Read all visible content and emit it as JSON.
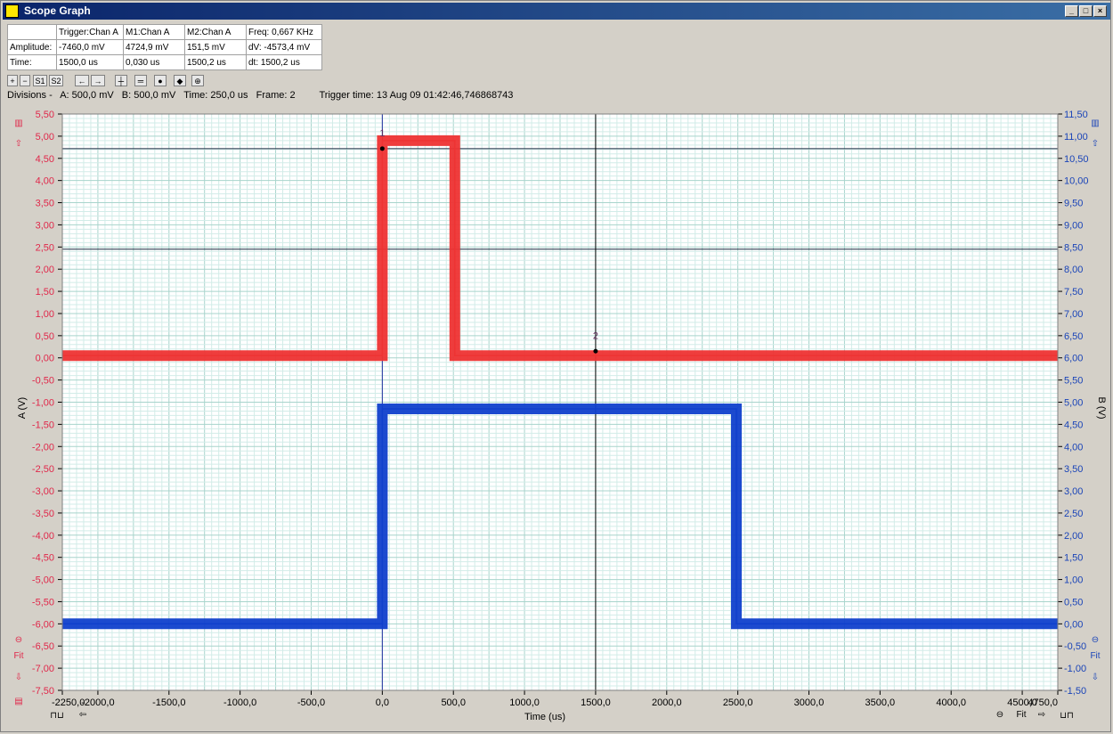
{
  "window": {
    "title": "Scope Graph"
  },
  "measurements": {
    "headers": [
      "",
      "Trigger:Chan A",
      "M1:Chan A",
      "M2:Chan A",
      "Freq: 0,667 KHz"
    ],
    "rows": [
      {
        "label": "Amplitude:",
        "trigger": "-7460,0 mV",
        "m1": "4724,9 mV",
        "m2": "151,5 mV",
        "delta": "dV: -4573,4 mV"
      },
      {
        "label": "Time:",
        "trigger": "1500,0 us",
        "m1": "0,030 us",
        "m2": "1500,2 us",
        "delta": "dt:  1500,2 us"
      }
    ]
  },
  "toolbar": {
    "zoom_in": "+",
    "zoom_out": "−",
    "s1": "S1",
    "s2": "S2"
  },
  "divisions": {
    "label": "Divisions -",
    "a": "A: 500,0 mV",
    "b": "B: 500,0 mV",
    "time": "Time: 250,0 us",
    "frame": "Frame: 2",
    "trigger_time": "Trigger time: 13 Aug 09 01:42:46,746868743"
  },
  "side_icons": {
    "fit_left": "Fit",
    "fit_right": "Fit"
  },
  "colors": {
    "chan_a": "#ee3333",
    "chan_b": "#1040cc",
    "grid_major": "#a8d4cc",
    "grid_minor": "#d2ece8",
    "axis_a_text": "#e0284a",
    "axis_b_text": "#1a44b8"
  },
  "chart_data": {
    "type": "line",
    "xlabel": "Time (us)",
    "ylabel_left": "A (V)",
    "ylabel_right": "B (V)",
    "xlim": [
      -2250,
      4750
    ],
    "ylim_left": [
      -7.5,
      5.5
    ],
    "ylim_right": [
      -1.5,
      11.5
    ],
    "x_ticks": [
      "-2250,0",
      "-2000,0",
      "-1500,0",
      "-1000,0",
      "-500,0",
      "0,0",
      "500,0",
      "1000,0",
      "1500,0",
      "2000,0",
      "2500,0",
      "3000,0",
      "3500,0",
      "4000,0",
      "4500,0",
      "4750,0"
    ],
    "y_ticks_left": [
      "5,50",
      "5,00",
      "4,50",
      "4,00",
      "3,50",
      "3,00",
      "2,50",
      "2,00",
      "1,50",
      "1,00",
      "0,50",
      "0,00",
      "-0,50",
      "-1,00",
      "-1,50",
      "-2,00",
      "-2,50",
      "-3,00",
      "-3,50",
      "-4,00",
      "-4,50",
      "-5,00",
      "-5,50",
      "-6,00",
      "-6,50",
      "-7,00",
      "-7,50"
    ],
    "y_ticks_right": [
      "11,50",
      "11,00",
      "10,50",
      "10,00",
      "9,50",
      "9,00",
      "8,50",
      "8,00",
      "7,50",
      "7,00",
      "6,50",
      "6,00",
      "5,50",
      "5,00",
      "4,50",
      "4,00",
      "3,50",
      "3,00",
      "2,50",
      "2,00",
      "1,50",
      "1,00",
      "0,50",
      "0,00",
      "-0,50",
      "-1,00",
      "-1,50"
    ],
    "grid": true,
    "series": [
      {
        "name": "A",
        "axis": "left",
        "x": [
          -2250,
          0,
          0,
          510,
          510,
          4750
        ],
        "y": [
          0.05,
          0.05,
          4.9,
          4.9,
          0.05,
          0.05
        ]
      },
      {
        "name": "B",
        "axis": "right",
        "x": [
          -2250,
          0,
          0,
          2490,
          2490,
          4750
        ],
        "y": [
          0.0,
          0.0,
          4.85,
          4.85,
          0.0,
          0.0
        ]
      }
    ],
    "markers": [
      {
        "label": "1",
        "x": 0,
        "y": 4.72
      },
      {
        "label": "2",
        "x": 1500,
        "y": 0.15
      }
    ],
    "cursor_lines": {
      "h_left": [
        4.72,
        2.45
      ],
      "v_x": [
        0,
        1500
      ]
    }
  }
}
